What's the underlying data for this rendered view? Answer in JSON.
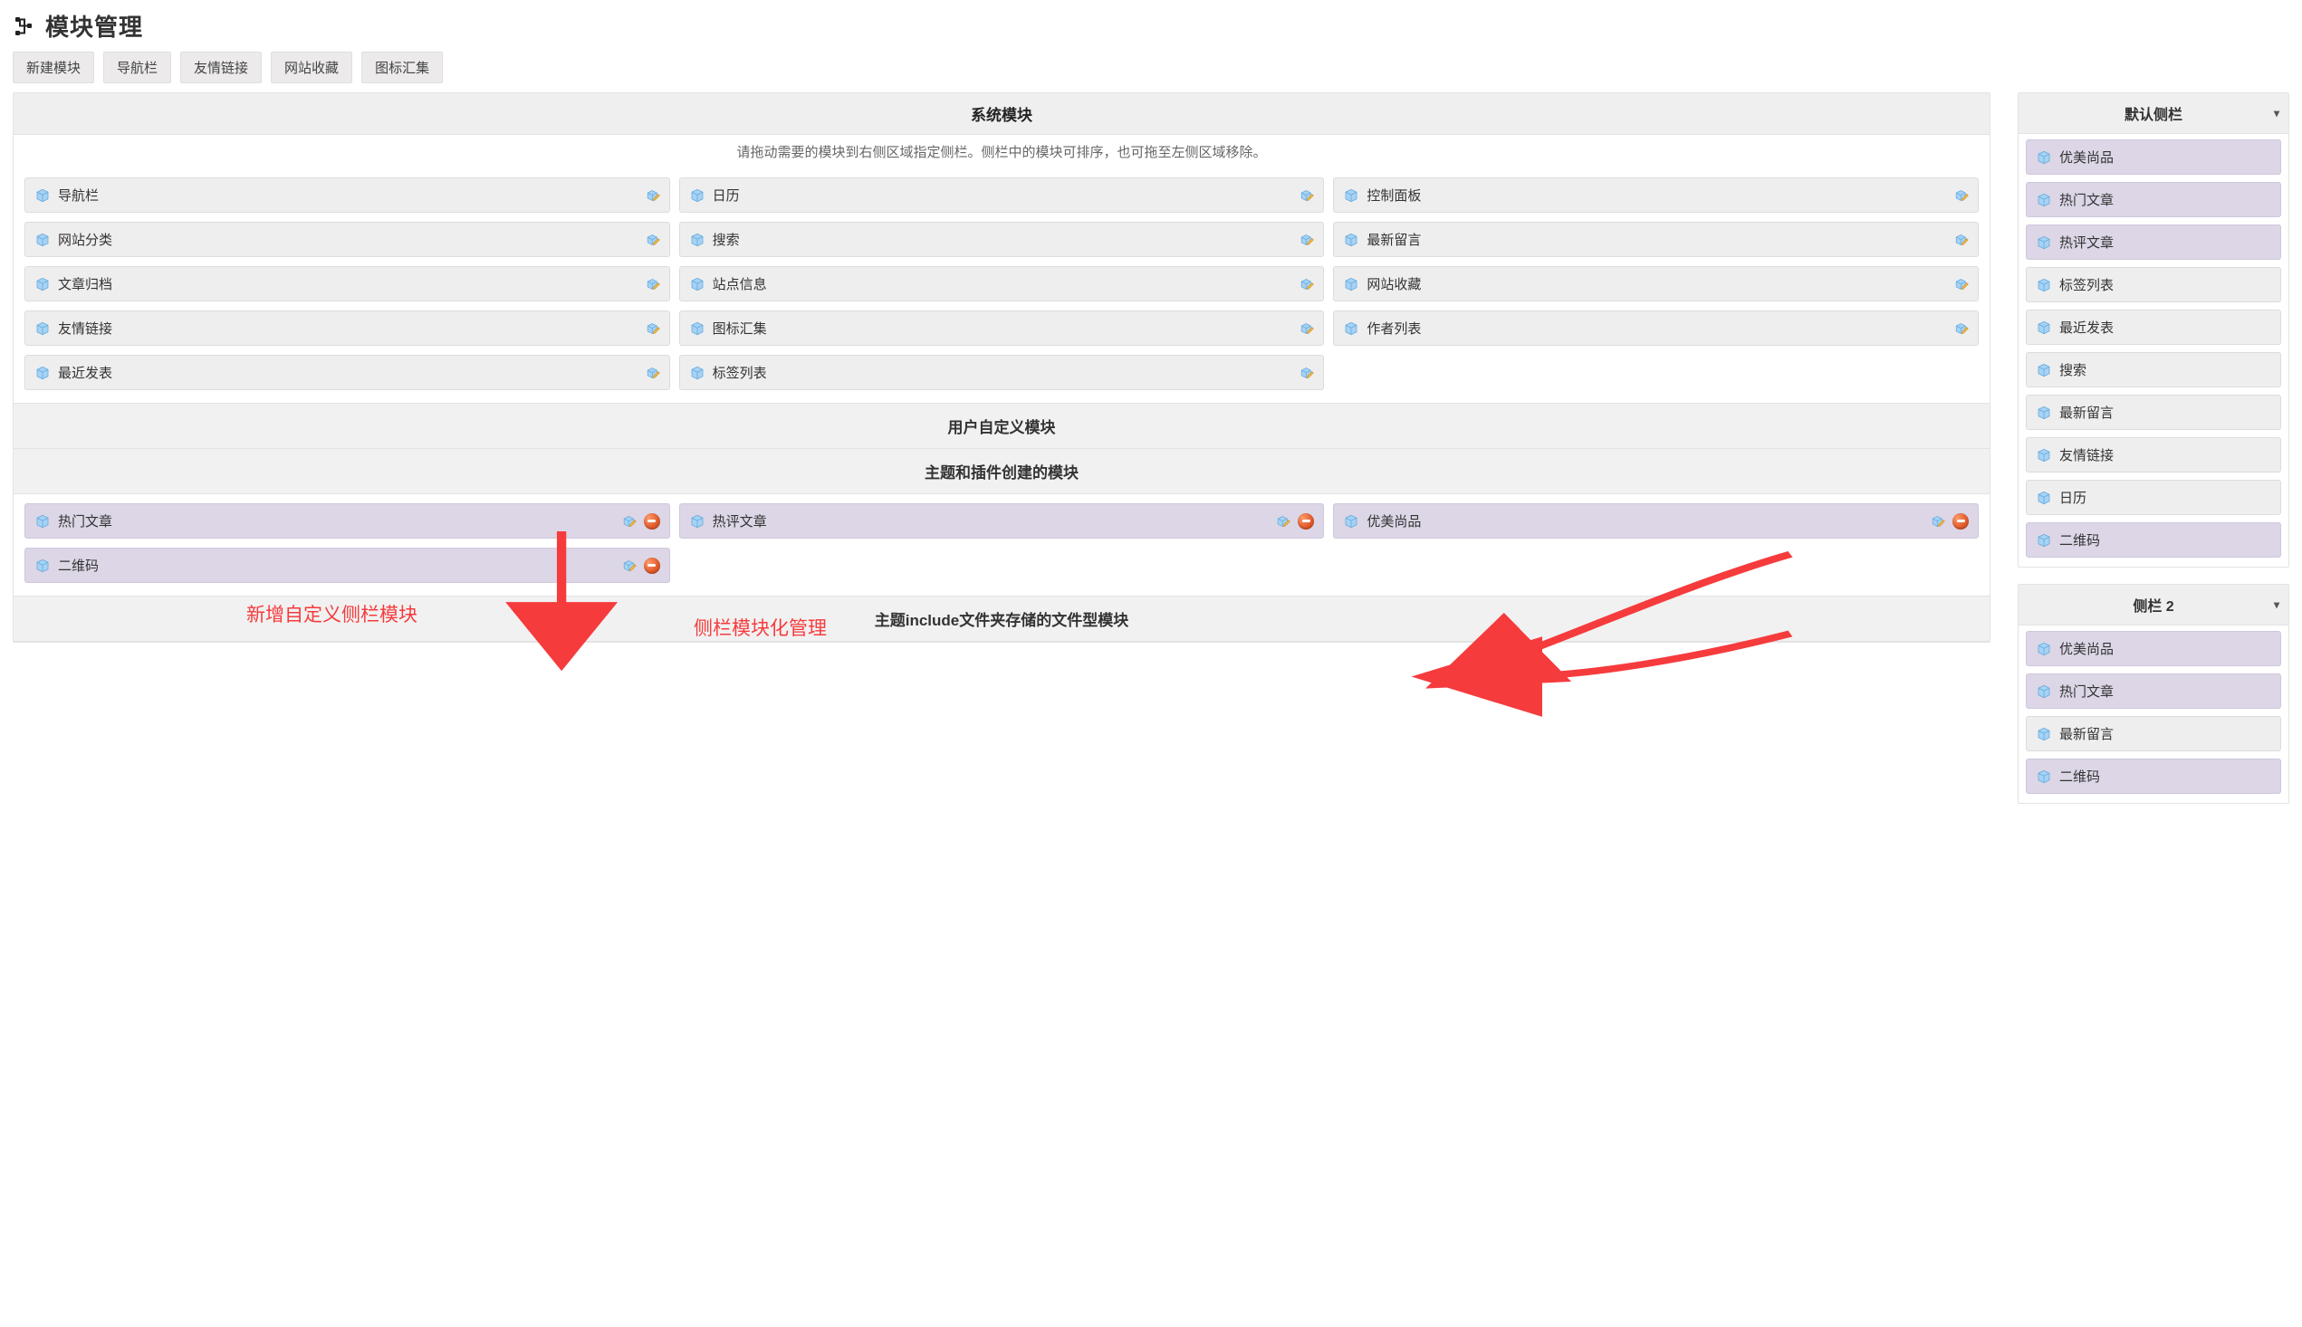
{
  "header": {
    "title": "模块管理"
  },
  "toolbar": {
    "new_module": "新建模块",
    "nav_bar": "导航栏",
    "friend_links": "友情链接",
    "site_favorites": "网站收藏",
    "icon_collection": "图标汇集"
  },
  "sections": {
    "system_title": "系统模块",
    "system_subtitle": "请拖动需要的模块到右侧区域指定侧栏。侧栏中的模块可排序，也可拖至左侧区域移除。",
    "user_custom_title": "用户自定义模块",
    "theme_plugin_title": "主题和插件创建的模块",
    "filetype_title": "主题include文件夹存储的文件型模块"
  },
  "system_modules": [
    "导航栏",
    "日历",
    "控制面板",
    "网站分类",
    "搜索",
    "最新留言",
    "文章归档",
    "站点信息",
    "网站收藏",
    "友情链接",
    "图标汇集",
    "作者列表",
    "最近发表",
    "标签列表"
  ],
  "theme_modules": [
    {
      "label": "热门文章",
      "removable": true
    },
    {
      "label": "热评文章",
      "removable": true
    },
    {
      "label": "优美尚品",
      "removable": true
    },
    {
      "label": "二维码",
      "removable": true
    }
  ],
  "sidebars": [
    {
      "title": "默认侧栏",
      "items": [
        {
          "label": "优美尚品",
          "tone": "purple"
        },
        {
          "label": "热门文章",
          "tone": "purple"
        },
        {
          "label": "热评文章",
          "tone": "purple"
        },
        {
          "label": "标签列表",
          "tone": "gray"
        },
        {
          "label": "最近发表",
          "tone": "gray"
        },
        {
          "label": "搜索",
          "tone": "gray"
        },
        {
          "label": "最新留言",
          "tone": "gray"
        },
        {
          "label": "友情链接",
          "tone": "gray"
        },
        {
          "label": "日历",
          "tone": "gray"
        },
        {
          "label": "二维码",
          "tone": "purple"
        }
      ]
    },
    {
      "title": "侧栏 2",
      "items": [
        {
          "label": "优美尚品",
          "tone": "purple"
        },
        {
          "label": "热门文章",
          "tone": "purple"
        },
        {
          "label": "最新留言",
          "tone": "gray"
        },
        {
          "label": "二维码",
          "tone": "purple"
        }
      ]
    }
  ],
  "annotations": {
    "left_text": "新增自定义侧栏模块",
    "right_text": "侧栏模块化管理"
  }
}
